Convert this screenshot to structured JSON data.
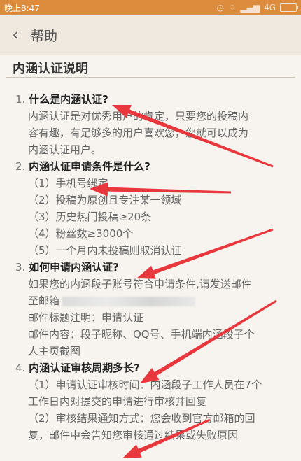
{
  "status_bar": {
    "time": "晚上8:47",
    "network": "4G",
    "icons": [
      "clock-icon",
      "wifi-icon",
      "signal-icon",
      "battery-icon"
    ]
  },
  "nav": {
    "back_icon": "‹",
    "title": "帮助"
  },
  "section_title": "内涵认证说明",
  "q1": {
    "num": "1.",
    "title": "什么是内涵认证?",
    "lines": [
      "内涵认证是对优秀用户的肯定，只要您的投稿内",
      "容有趣，有足够多的用户喜欢您，您就可以成为",
      "内涵认证用户。"
    ]
  },
  "q2": {
    "num": "2.",
    "title": "内涵认证申请条件是什么?",
    "lines": [
      "（1）手机号绑定",
      "（2）投稿为原创且专注某一领域",
      "（3）历史热门投稿≥20条",
      "（4）粉丝数≥3000个",
      "（5）一个月内未投稿则取消认证"
    ]
  },
  "q3": {
    "num": "3.",
    "title": "如何申请内涵认证?",
    "line1": "如果您的内涵段子账号符合申请条件,请发送邮件",
    "line2": "至邮箱",
    "line3": "邮件标题注明：申请认证",
    "line4": "邮件内容：段子昵称、QQ号、手机端内涵段子个",
    "line5": "人主页截图"
  },
  "q4": {
    "num": "4.",
    "title": "内涵认证审核周期多长?",
    "lines": [
      "（1）申请认证审核时间：内涵段子工作人员在7个",
      "工作日内对提交的申请进行审核并回复",
      "（2）审核结果通知方式：您会收到官方邮箱的回",
      "复，邮件中会告知您审核通过结果或失败原因"
    ]
  },
  "annotation_color": "#e8383d"
}
